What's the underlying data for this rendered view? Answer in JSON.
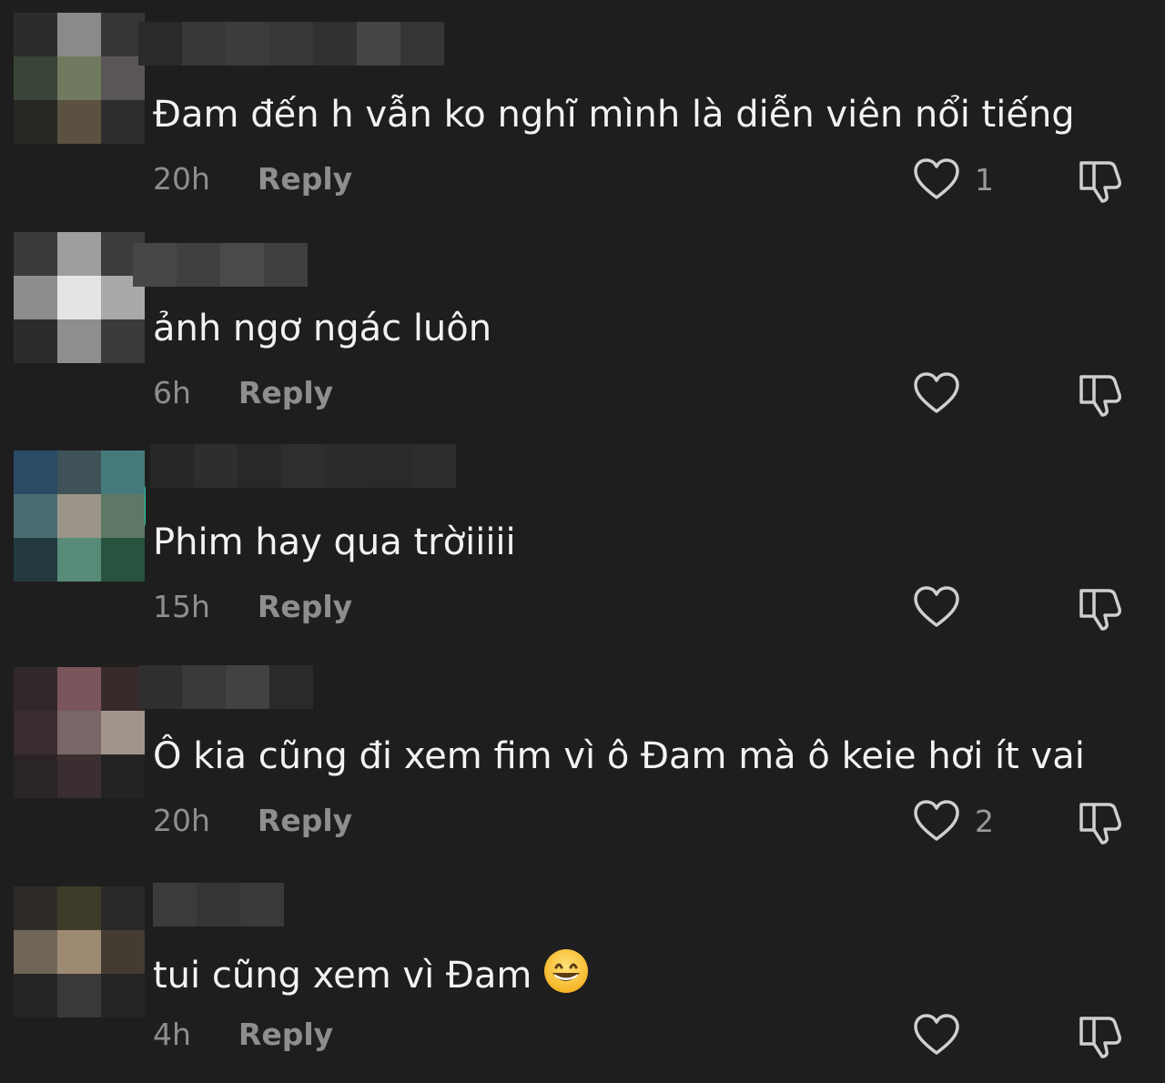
{
  "comments": [
    {
      "text": "Đam đến h vẫn ko nghĩ mình là diễn viên nổi tiếng",
      "time": "20h",
      "reply_label": "Reply",
      "likes": "1",
      "avatar_colors": [
        "#2c2c2c",
        "#8a8a8a",
        "#363636",
        "#3b4438",
        "#6f7a5e",
        "#5a5656",
        "#262823",
        "#5a5140",
        "#2d2d2d"
      ],
      "username_colors": [
        "#2a2a2a",
        "#383838",
        "#3c3c3c",
        "#373737",
        "#313131",
        "#454545",
        "#353535"
      ]
    },
    {
      "text": "ảnh ngơ ngác luôn",
      "time": "6h",
      "reply_label": "Reply",
      "likes": "",
      "avatar_colors": [
        "#3a3a3a",
        "#9e9e9e",
        "#3c3c3c",
        "#8d8d8d",
        "#e4e4e4",
        "#a9a9a9",
        "#2c2c2c",
        "#8e8e8e",
        "#3a3a3a"
      ],
      "username_colors": [
        "#474747",
        "#404040",
        "#4a4a4a",
        "#404040"
      ]
    },
    {
      "text": "Phim hay qua trờiiiii",
      "time": "15h",
      "reply_label": "Reply",
      "likes": "",
      "avatar_colors": [
        "#2a4a66",
        "#3e5258",
        "#46797a",
        "#4c6c73",
        "#9b958a",
        "#5e7866",
        "#23393f",
        "#578a77",
        "#28533f"
      ],
      "username_colors": [
        "#272727",
        "#2e2e2e",
        "#282828",
        "#2f2f2f",
        "#2c2c2c",
        "#2a2a2a",
        "#2d2d2d"
      ]
    },
    {
      "text": "Ô kia cũng đi xem fim vì ô Đam mà ô keie hơi ít vai",
      "time": "20h",
      "reply_label": "Reply",
      "likes": "2",
      "avatar_colors": [
        "#322829",
        "#7a555b",
        "#382a2b",
        "#3a2d2f",
        "#786668",
        "#a0958b",
        "#2a2424",
        "#3a2e30",
        "#242222"
      ],
      "username_colors": [
        "#2f2f2f",
        "#393939",
        "#424242",
        "#2a2a2a"
      ]
    },
    {
      "text": "tui cũng xem vì Đam",
      "time": "4h",
      "reply_label": "Reply",
      "likes": "",
      "avatar_colors": [
        "#2f2a26",
        "#3c3c28",
        "#2a2826",
        "#6e6558",
        "#9c8a73",
        "#443b33",
        "#242424",
        "#3a3838",
        "#252525"
      ],
      "username_colors": [
        "#3b3b3b",
        "#353535",
        "#3a3a3a"
      ]
    }
  ],
  "icons": {
    "like": "heart-outline-icon",
    "dislike": "thumbs-down-icon",
    "emoji": "grinning-face-emoji"
  }
}
